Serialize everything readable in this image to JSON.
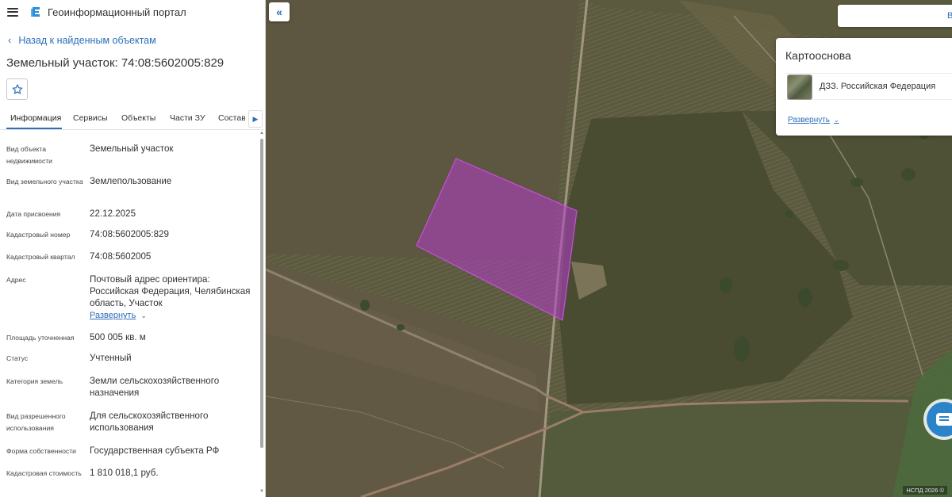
{
  "header": {
    "app_title": "Геоинформационный портал"
  },
  "nav": {
    "back_label": "Назад к найденным объектам"
  },
  "object": {
    "title": "Земельный участок: 74:08:5602005:829"
  },
  "tabs": [
    {
      "label": "Информация",
      "active": true
    },
    {
      "label": "Сервисы"
    },
    {
      "label": "Объекты"
    },
    {
      "label": "Части ЗУ"
    },
    {
      "label": "Состав"
    }
  ],
  "properties": [
    {
      "label": "Вид объекта недвижимости",
      "value": "Земельный участок"
    },
    {
      "label": "Вид земельного участка",
      "value": "Землепользование"
    },
    {
      "label": "Дата присвоения",
      "value": "22.12.2025"
    },
    {
      "label": "Кадастровый номер",
      "value": "74:08:5602005:829"
    },
    {
      "label": "Кадастровый квартал",
      "value": "74:08:5602005"
    },
    {
      "label": "Адрес",
      "value": "Почтовый адрес ориентира: Российская Федерация, Челябинская область, Участок",
      "link": "Развернуть"
    },
    {
      "label": "Площадь уточненная",
      "value": "500 005 кв. м"
    },
    {
      "label": "Статус",
      "value": "Учтенный"
    },
    {
      "label": "Категория земель",
      "value": "Земли сельскохозяйственного назначения"
    },
    {
      "label": "Вид разрешенного использования",
      "value": "Для сельскохозяйственного использования"
    },
    {
      "label": "Форма собственности",
      "value": "Государственная субъекта РФ"
    },
    {
      "label": "Кадастровая стоимость",
      "value": "1 810 018,1 руб."
    }
  ],
  "map": {
    "search_partial": "Ве",
    "basemap": {
      "title": "Картооснова",
      "item_label": "ДЗЗ. Российская Федерация",
      "expand_label": "Развернуть"
    },
    "copyright": "НСПД 2026 ©"
  },
  "colors": {
    "accent": "#2a6fb8",
    "parcel": "#b43cc8",
    "chat": "#2b84c9"
  }
}
